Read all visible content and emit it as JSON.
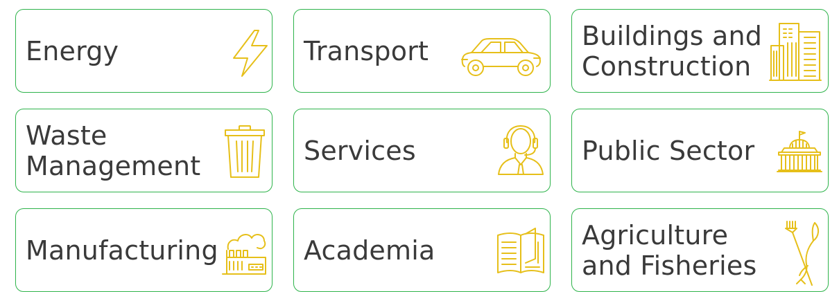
{
  "tiles": [
    {
      "label": "Energy",
      "icon": "lightning-bolt-icon"
    },
    {
      "label": "Transport",
      "icon": "car-icon"
    },
    {
      "label": "Buildings and\nConstruction",
      "icon": "office-buildings-icon"
    },
    {
      "label": "Waste\nManagement",
      "icon": "trash-bin-icon"
    },
    {
      "label": "Services",
      "icon": "headset-agent-icon"
    },
    {
      "label": "Public Sector",
      "icon": "parliament-building-icon"
    },
    {
      "label": "Manufacturing",
      "icon": "factory-icon"
    },
    {
      "label": "Academia",
      "icon": "open-book-icon"
    },
    {
      "label": "Agriculture\nand Fisheries",
      "icon": "fork-and-fish-icon"
    }
  ],
  "colors": {
    "border": "#2db34a",
    "icon": "#e6bf19",
    "text": "#3a3a3a"
  }
}
